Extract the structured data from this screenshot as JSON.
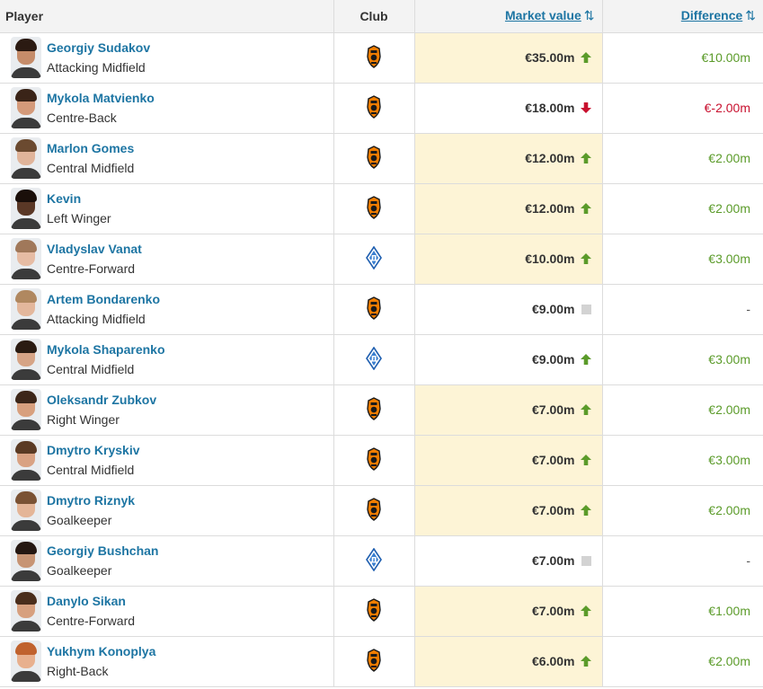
{
  "header": {
    "player": "Player",
    "club": "Club",
    "market_value": "Market value",
    "difference": "Difference",
    "sort_icon": "⇅"
  },
  "colors": {
    "link": "#1d75a3",
    "positive": "#5b9b2a",
    "negative": "#c8102e",
    "highlight": "#fdf4d6"
  },
  "rows": [
    {
      "name": "Georgiy Sudakov",
      "position": "Attacking Midfield",
      "club": "shakhtar",
      "value": "€35.00m",
      "trend": "up",
      "diff": "€10.00m",
      "diff_type": "pos",
      "highlight": true,
      "skin": "#c58c6a",
      "hair": "#2b1a12"
    },
    {
      "name": "Mykola Matvienko",
      "position": "Centre-Back",
      "club": "shakhtar",
      "value": "€18.00m",
      "trend": "down",
      "diff": "€-2.00m",
      "diff_type": "neg",
      "highlight": false,
      "skin": "#d49a7a",
      "hair": "#3a2418"
    },
    {
      "name": "Marlon Gomes",
      "position": "Central Midfield",
      "club": "shakhtar",
      "value": "€12.00m",
      "trend": "up",
      "diff": "€2.00m",
      "diff_type": "pos",
      "highlight": true,
      "skin": "#e0b49a",
      "hair": "#6b4a30"
    },
    {
      "name": "Kevin",
      "position": "Left Winger",
      "club": "shakhtar",
      "value": "€12.00m",
      "trend": "up",
      "diff": "€2.00m",
      "diff_type": "pos",
      "highlight": true,
      "skin": "#5a3826",
      "hair": "#1a0f0a"
    },
    {
      "name": "Vladyslav Vanat",
      "position": "Centre-Forward",
      "club": "dynamo",
      "value": "€10.00m",
      "trend": "up",
      "diff": "€3.00m",
      "diff_type": "pos",
      "highlight": true,
      "skin": "#e6bca4",
      "hair": "#a0785a"
    },
    {
      "name": "Artem Bondarenko",
      "position": "Attacking Midfield",
      "club": "shakhtar",
      "value": "€9.00m",
      "trend": "same",
      "diff": "-",
      "diff_type": "neutral",
      "highlight": false,
      "skin": "#e3b79c",
      "hair": "#b08860"
    },
    {
      "name": "Mykola Shaparenko",
      "position": "Central Midfield",
      "club": "dynamo",
      "value": "€9.00m",
      "trend": "up",
      "diff": "€3.00m",
      "diff_type": "pos",
      "highlight": false,
      "skin": "#d6a486",
      "hair": "#2a1b12"
    },
    {
      "name": "Oleksandr Zubkov",
      "position": "Right Winger",
      "club": "shakhtar",
      "value": "€7.00m",
      "trend": "up",
      "diff": "€2.00m",
      "diff_type": "pos",
      "highlight": true,
      "skin": "#d8a07e",
      "hair": "#3c2619"
    },
    {
      "name": "Dmytro Kryskiv",
      "position": "Central Midfield",
      "club": "shakhtar",
      "value": "€7.00m",
      "trend": "up",
      "diff": "€3.00m",
      "diff_type": "pos",
      "highlight": true,
      "skin": "#d9a283",
      "hair": "#5a3a24"
    },
    {
      "name": "Dmytro Riznyk",
      "position": "Goalkeeper",
      "club": "shakhtar",
      "value": "€7.00m",
      "trend": "up",
      "diff": "€2.00m",
      "diff_type": "pos",
      "highlight": true,
      "skin": "#e4b597",
      "hair": "#7a5234"
    },
    {
      "name": "Georgiy Bushchan",
      "position": "Goalkeeper",
      "club": "dynamo",
      "value": "€7.00m",
      "trend": "same",
      "diff": "-",
      "diff_type": "neutral",
      "highlight": false,
      "skin": "#c79474",
      "hair": "#241712"
    },
    {
      "name": "Danylo Sikan",
      "position": "Centre-Forward",
      "club": "shakhtar",
      "value": "€7.00m",
      "trend": "up",
      "diff": "€1.00m",
      "diff_type": "pos",
      "highlight": true,
      "skin": "#d7a07f",
      "hair": "#4a2e1c"
    },
    {
      "name": "Yukhym Konoplya",
      "position": "Right-Back",
      "club": "shakhtar",
      "value": "€6.00m",
      "trend": "up",
      "diff": "€2.00m",
      "diff_type": "pos",
      "highlight": true,
      "skin": "#e8b08e",
      "hair": "#c0622e"
    }
  ]
}
